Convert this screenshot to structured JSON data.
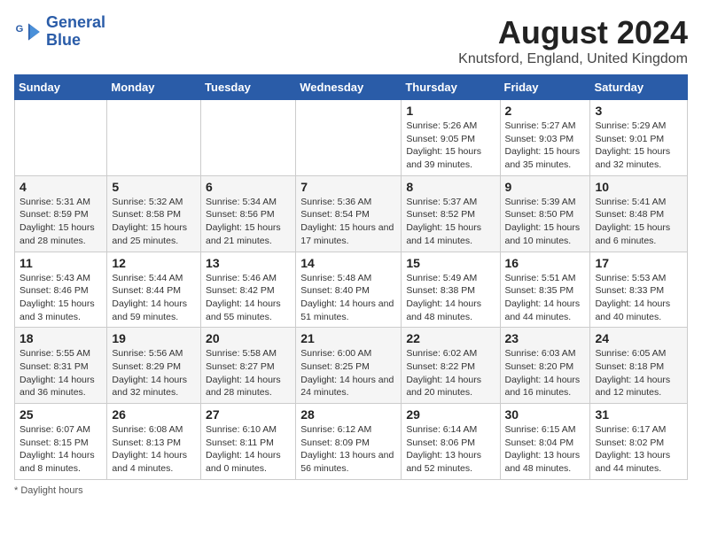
{
  "header": {
    "logo_line1": "General",
    "logo_line2": "Blue",
    "month_year": "August 2024",
    "location": "Knutsford, England, United Kingdom"
  },
  "days_of_week": [
    "Sunday",
    "Monday",
    "Tuesday",
    "Wednesday",
    "Thursday",
    "Friday",
    "Saturday"
  ],
  "weeks": [
    [
      {
        "day": "",
        "sunrise": "",
        "sunset": "",
        "daylight": ""
      },
      {
        "day": "",
        "sunrise": "",
        "sunset": "",
        "daylight": ""
      },
      {
        "day": "",
        "sunrise": "",
        "sunset": "",
        "daylight": ""
      },
      {
        "day": "",
        "sunrise": "",
        "sunset": "",
        "daylight": ""
      },
      {
        "day": "1",
        "sunrise": "Sunrise: 5:26 AM",
        "sunset": "Sunset: 9:05 PM",
        "daylight": "Daylight: 15 hours and 39 minutes."
      },
      {
        "day": "2",
        "sunrise": "Sunrise: 5:27 AM",
        "sunset": "Sunset: 9:03 PM",
        "daylight": "Daylight: 15 hours and 35 minutes."
      },
      {
        "day": "3",
        "sunrise": "Sunrise: 5:29 AM",
        "sunset": "Sunset: 9:01 PM",
        "daylight": "Daylight: 15 hours and 32 minutes."
      }
    ],
    [
      {
        "day": "4",
        "sunrise": "Sunrise: 5:31 AM",
        "sunset": "Sunset: 8:59 PM",
        "daylight": "Daylight: 15 hours and 28 minutes."
      },
      {
        "day": "5",
        "sunrise": "Sunrise: 5:32 AM",
        "sunset": "Sunset: 8:58 PM",
        "daylight": "Daylight: 15 hours and 25 minutes."
      },
      {
        "day": "6",
        "sunrise": "Sunrise: 5:34 AM",
        "sunset": "Sunset: 8:56 PM",
        "daylight": "Daylight: 15 hours and 21 minutes."
      },
      {
        "day": "7",
        "sunrise": "Sunrise: 5:36 AM",
        "sunset": "Sunset: 8:54 PM",
        "daylight": "Daylight: 15 hours and 17 minutes."
      },
      {
        "day": "8",
        "sunrise": "Sunrise: 5:37 AM",
        "sunset": "Sunset: 8:52 PM",
        "daylight": "Daylight: 15 hours and 14 minutes."
      },
      {
        "day": "9",
        "sunrise": "Sunrise: 5:39 AM",
        "sunset": "Sunset: 8:50 PM",
        "daylight": "Daylight: 15 hours and 10 minutes."
      },
      {
        "day": "10",
        "sunrise": "Sunrise: 5:41 AM",
        "sunset": "Sunset: 8:48 PM",
        "daylight": "Daylight: 15 hours and 6 minutes."
      }
    ],
    [
      {
        "day": "11",
        "sunrise": "Sunrise: 5:43 AM",
        "sunset": "Sunset: 8:46 PM",
        "daylight": "Daylight: 15 hours and 3 minutes."
      },
      {
        "day": "12",
        "sunrise": "Sunrise: 5:44 AM",
        "sunset": "Sunset: 8:44 PM",
        "daylight": "Daylight: 14 hours and 59 minutes."
      },
      {
        "day": "13",
        "sunrise": "Sunrise: 5:46 AM",
        "sunset": "Sunset: 8:42 PM",
        "daylight": "Daylight: 14 hours and 55 minutes."
      },
      {
        "day": "14",
        "sunrise": "Sunrise: 5:48 AM",
        "sunset": "Sunset: 8:40 PM",
        "daylight": "Daylight: 14 hours and 51 minutes."
      },
      {
        "day": "15",
        "sunrise": "Sunrise: 5:49 AM",
        "sunset": "Sunset: 8:38 PM",
        "daylight": "Daylight: 14 hours and 48 minutes."
      },
      {
        "day": "16",
        "sunrise": "Sunrise: 5:51 AM",
        "sunset": "Sunset: 8:35 PM",
        "daylight": "Daylight: 14 hours and 44 minutes."
      },
      {
        "day": "17",
        "sunrise": "Sunrise: 5:53 AM",
        "sunset": "Sunset: 8:33 PM",
        "daylight": "Daylight: 14 hours and 40 minutes."
      }
    ],
    [
      {
        "day": "18",
        "sunrise": "Sunrise: 5:55 AM",
        "sunset": "Sunset: 8:31 PM",
        "daylight": "Daylight: 14 hours and 36 minutes."
      },
      {
        "day": "19",
        "sunrise": "Sunrise: 5:56 AM",
        "sunset": "Sunset: 8:29 PM",
        "daylight": "Daylight: 14 hours and 32 minutes."
      },
      {
        "day": "20",
        "sunrise": "Sunrise: 5:58 AM",
        "sunset": "Sunset: 8:27 PM",
        "daylight": "Daylight: 14 hours and 28 minutes."
      },
      {
        "day": "21",
        "sunrise": "Sunrise: 6:00 AM",
        "sunset": "Sunset: 8:25 PM",
        "daylight": "Daylight: 14 hours and 24 minutes."
      },
      {
        "day": "22",
        "sunrise": "Sunrise: 6:02 AM",
        "sunset": "Sunset: 8:22 PM",
        "daylight": "Daylight: 14 hours and 20 minutes."
      },
      {
        "day": "23",
        "sunrise": "Sunrise: 6:03 AM",
        "sunset": "Sunset: 8:20 PM",
        "daylight": "Daylight: 14 hours and 16 minutes."
      },
      {
        "day": "24",
        "sunrise": "Sunrise: 6:05 AM",
        "sunset": "Sunset: 8:18 PM",
        "daylight": "Daylight: 14 hours and 12 minutes."
      }
    ],
    [
      {
        "day": "25",
        "sunrise": "Sunrise: 6:07 AM",
        "sunset": "Sunset: 8:15 PM",
        "daylight": "Daylight: 14 hours and 8 minutes."
      },
      {
        "day": "26",
        "sunrise": "Sunrise: 6:08 AM",
        "sunset": "Sunset: 8:13 PM",
        "daylight": "Daylight: 14 hours and 4 minutes."
      },
      {
        "day": "27",
        "sunrise": "Sunrise: 6:10 AM",
        "sunset": "Sunset: 8:11 PM",
        "daylight": "Daylight: 14 hours and 0 minutes."
      },
      {
        "day": "28",
        "sunrise": "Sunrise: 6:12 AM",
        "sunset": "Sunset: 8:09 PM",
        "daylight": "Daylight: 13 hours and 56 minutes."
      },
      {
        "day": "29",
        "sunrise": "Sunrise: 6:14 AM",
        "sunset": "Sunset: 8:06 PM",
        "daylight": "Daylight: 13 hours and 52 minutes."
      },
      {
        "day": "30",
        "sunrise": "Sunrise: 6:15 AM",
        "sunset": "Sunset: 8:04 PM",
        "daylight": "Daylight: 13 hours and 48 minutes."
      },
      {
        "day": "31",
        "sunrise": "Sunrise: 6:17 AM",
        "sunset": "Sunset: 8:02 PM",
        "daylight": "Daylight: 13 hours and 44 minutes."
      }
    ]
  ],
  "footer": {
    "note": "Daylight hours"
  }
}
